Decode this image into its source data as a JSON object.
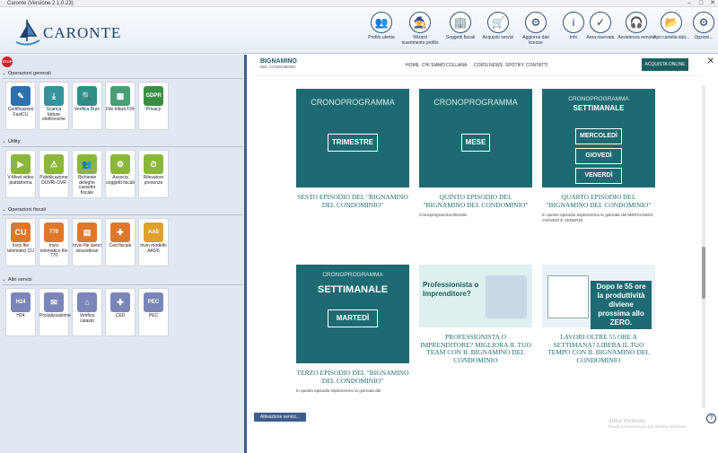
{
  "window": {
    "title": "Caronte (Versione 2.1.0.23)"
  },
  "app": {
    "name": "CARONTE"
  },
  "toolbar": [
    {
      "label": "Profilo utente",
      "icon": "users-icon",
      "glyph": "👥"
    },
    {
      "label": "Wizard inserimento profilo",
      "icon": "wizard-icon",
      "glyph": "🧙"
    },
    {
      "label": "Soggetti fiscali",
      "icon": "building-icon",
      "glyph": "🏢"
    },
    {
      "label": "Acquisto servizi",
      "icon": "cart-icon",
      "glyph": "🛒"
    },
    {
      "label": "Aggiorna dati licenze",
      "icon": "license-icon",
      "glyph": "⚙"
    },
    {
      "label": "Info",
      "icon": "info-icon",
      "glyph": "i"
    },
    {
      "label": "Area riservata",
      "icon": "monitor-check-icon",
      "glyph": "✓"
    },
    {
      "label": "Assistenza remota",
      "icon": "headset-icon",
      "glyph": "🎧"
    },
    {
      "label": "Apri cartella dati...",
      "icon": "folder-icon",
      "glyph": "📂"
    },
    {
      "label": "Opzioni...",
      "icon": "gear-icon",
      "glyph": "⚙"
    }
  ],
  "stop_label": "STOP",
  "sections": [
    {
      "title": "Operazioni generali",
      "cards": [
        {
          "label": "Certificazioni FastCU",
          "color": "#2e6fae",
          "glyph": "✎"
        },
        {
          "label": "Scarica fatture elettroniche",
          "color": "#35939c",
          "glyph": "⤓"
        },
        {
          "label": "Verifica Durc",
          "color": "#2e8f86",
          "glyph": "🔍"
        },
        {
          "label": "File tributi F24",
          "color": "#4a9e76",
          "glyph": "▦"
        },
        {
          "label": "Privacy",
          "color": "#3b8f45",
          "glyph": "GDPR"
        }
      ]
    },
    {
      "title": "Utility",
      "cards": [
        {
          "label": "V-Meet video piattaforma",
          "color": "#8bb63c",
          "glyph": "▶"
        },
        {
          "label": "Pubblicazione DUVRI-DVR",
          "color": "#8bb63c",
          "glyph": "⚠"
        },
        {
          "label": "Richieste deleghe cassetto fiscale",
          "color": "#8bb63c",
          "glyph": "👥"
        },
        {
          "label": "Associa soggetti fiscali",
          "color": "#8bb63c",
          "glyph": "⚙"
        },
        {
          "label": "Rilevatore presenze",
          "color": "#8bb63c",
          "glyph": "⏱"
        }
      ]
    },
    {
      "title": "Operazioni fiscali",
      "cards": [
        {
          "label": "Invio file telematici CU",
          "color": "#e0772a",
          "glyph": "CU"
        },
        {
          "label": "Invio telematico file 770",
          "color": "#e0772a",
          "glyph": "770"
        },
        {
          "label": "Invio file lavori straordinari",
          "color": "#e0772a",
          "glyph": "▤"
        },
        {
          "label": "Ced fiscale",
          "color": "#e0772a",
          "glyph": "✚"
        },
        {
          "label": "Invio modello AA5/6",
          "color": "#e0a12a",
          "glyph": "AA5"
        }
      ]
    },
    {
      "title": "Altri servizi",
      "cards": [
        {
          "label": "H24",
          "color": "#7b86b8",
          "glyph": "H24"
        },
        {
          "label": "Postalizzazione",
          "color": "#7b86b8",
          "glyph": "✉"
        },
        {
          "label": "Verifica catasto",
          "color": "#7b86b8",
          "glyph": "⌂"
        },
        {
          "label": "CED",
          "color": "#7b86b8",
          "glyph": "✚"
        },
        {
          "label": "PEC",
          "color": "#7b86b8",
          "glyph": "PEC"
        }
      ]
    }
  ],
  "site": {
    "logo": "BIGNAMINO",
    "logo_sub": "DEL CONDOMINIO",
    "nav": [
      "HOME",
      "CHI SIAMO",
      "COLLANA",
      "CORSI",
      "NEWS",
      "SPOTIFY",
      "CONTATTI"
    ],
    "shop": "ACQUISTA ONLINE"
  },
  "posts": [
    {
      "img_title": "CRONOPROGRAMMA",
      "img_sub": "",
      "boxes": [
        "TRIMESTRE"
      ],
      "title": "SESTO EPISODIO DEL \"BIGNAMINO DEL CONDOMINIO\"",
      "desc": ""
    },
    {
      "img_title": "CRONOPROGRAMMA",
      "img_sub": "",
      "boxes": [
        "MESE"
      ],
      "title": "QUINTO EPISODIO DEL \"BIGNAMINO DEL CONDOMINIO\"",
      "desc": "Cronoprogramma Mensile"
    },
    {
      "img_title": "CRONOPROGRAMMA",
      "img_sub": "SETTIMANALE",
      "boxes": [
        "MERCOLEDÌ",
        "GIOVEDÌ",
        "VENERDÌ"
      ],
      "title": "QUARTO EPISODIO DEL \"BIGNAMINO DEL CONDOMINIO\"",
      "desc": "In questo episodio esploreremo le giornate del MERCOLEDÌ, GIOVEDÌ E VENERDÌ."
    },
    {
      "img_title": "CRONOPROGRAMMA",
      "img_sub": "SETTIMANALE",
      "boxes": [
        "MARTEDÌ"
      ],
      "title": "TERZO EPISODIO DEL \"BIGNAMINO DEL CONDOMINIO\"",
      "desc": "In questo episodio esploreremo la giornata del"
    },
    {
      "img_text": "Professionista o Imprenditore?",
      "title": "PROFESSIONISTA O IMPRENDITORE? MIGLIORA IL TUO TEAM CON IL BIGNAMINO DEL CONDOMINIO",
      "desc": ""
    },
    {
      "img_text": "Dopo le 55 ore la produttività diviene prossima allo ZERO.",
      "title": "LAVORI OLTRE 55 ORE A SETTIMANA? LIBERA IL TUO TEMPO CON IL BIGNAMINO DEL CONDOMINIO",
      "desc": ""
    }
  ],
  "attivazione": "Attivazione servizi...",
  "watermark": {
    "line1": "Attiva Windows",
    "line2": "Passa a Impostazioni per attivare Windows."
  },
  "close_glyph": "✕",
  "help_glyph": "?"
}
